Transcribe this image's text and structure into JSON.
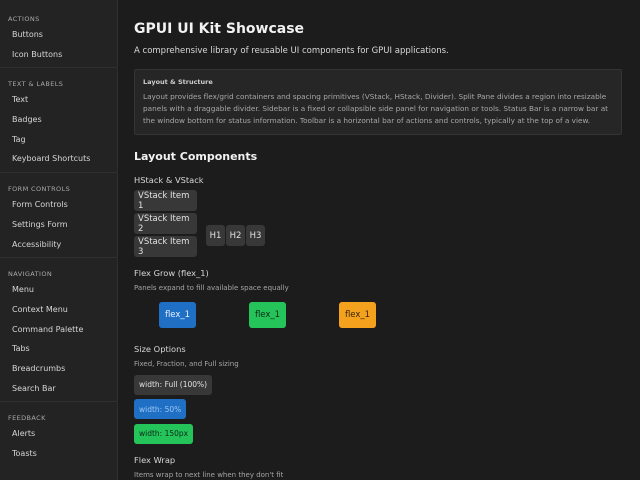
{
  "sidebar": {
    "sections": [
      {
        "title": "ACTIONS",
        "items": [
          "Buttons",
          "Icon Buttons"
        ]
      },
      {
        "title": "TEXT & LABELS",
        "items": [
          "Text",
          "Badges",
          "Tag",
          "Keyboard Shortcuts"
        ]
      },
      {
        "title": "FORM CONTROLS",
        "items": [
          "Form Controls",
          "Settings Form",
          "Accessibility"
        ]
      },
      {
        "title": "NAVIGATION",
        "items": [
          "Menu",
          "Context Menu",
          "Command Palette",
          "Tabs",
          "Breadcrumbs",
          "Search Bar"
        ]
      },
      {
        "title": "FEEDBACK",
        "items": [
          "Alerts",
          "Toasts"
        ]
      }
    ]
  },
  "main": {
    "title": "GPUI UI Kit Showcase",
    "subtitle": "A comprehensive library of reusable UI components for GPUI applications.",
    "info": {
      "title": "Layout & Structure",
      "text": "Layout provides flex/grid containers and spacing primitives (VStack, HStack, Divider). Split Pane divides a region into resizable panels with a draggable divider. Sidebar is a fixed or collapsible side panel for navigation or tools. Status Bar is a narrow bar at the window bottom for status information. Toolbar is a horizontal bar of actions and controls, typically at the top of a view."
    },
    "layout_heading": "Layout Components",
    "stack": {
      "heading": "HStack & VStack",
      "vstack_items": [
        "VStack Item 1",
        "VStack Item 2",
        "VStack Item 3"
      ],
      "hstack_items": [
        "H1",
        "H2",
        "H3"
      ]
    },
    "flex_grow": {
      "heading": "Flex Grow (flex_1)",
      "desc": "Panels expand to fill available space equally",
      "panels": [
        {
          "label": "flex_1",
          "color": "#1f6fc5",
          "text": "#e8f0ff"
        },
        {
          "label": "flex_1",
          "color": "#25c45a",
          "text": "#0d2a16"
        },
        {
          "label": "flex_1",
          "color": "#f4a21e",
          "text": "#3a2405"
        }
      ]
    },
    "size": {
      "heading": "Size Options",
      "desc": "Fixed, Fraction, and Full sizing",
      "items": [
        {
          "label": "width: Full (100%)",
          "color": "#383838",
          "text": "#e2e2e2"
        },
        {
          "label": "width: 50%",
          "color": "#1f6fc5",
          "text": "#9cc6f2"
        },
        {
          "label": "width: 150px",
          "color": "#25c45a",
          "text": "#0d2a16"
        }
      ]
    },
    "wrap": {
      "heading": "Flex Wrap",
      "desc": "Items wrap to next line when they don't fit"
    }
  }
}
